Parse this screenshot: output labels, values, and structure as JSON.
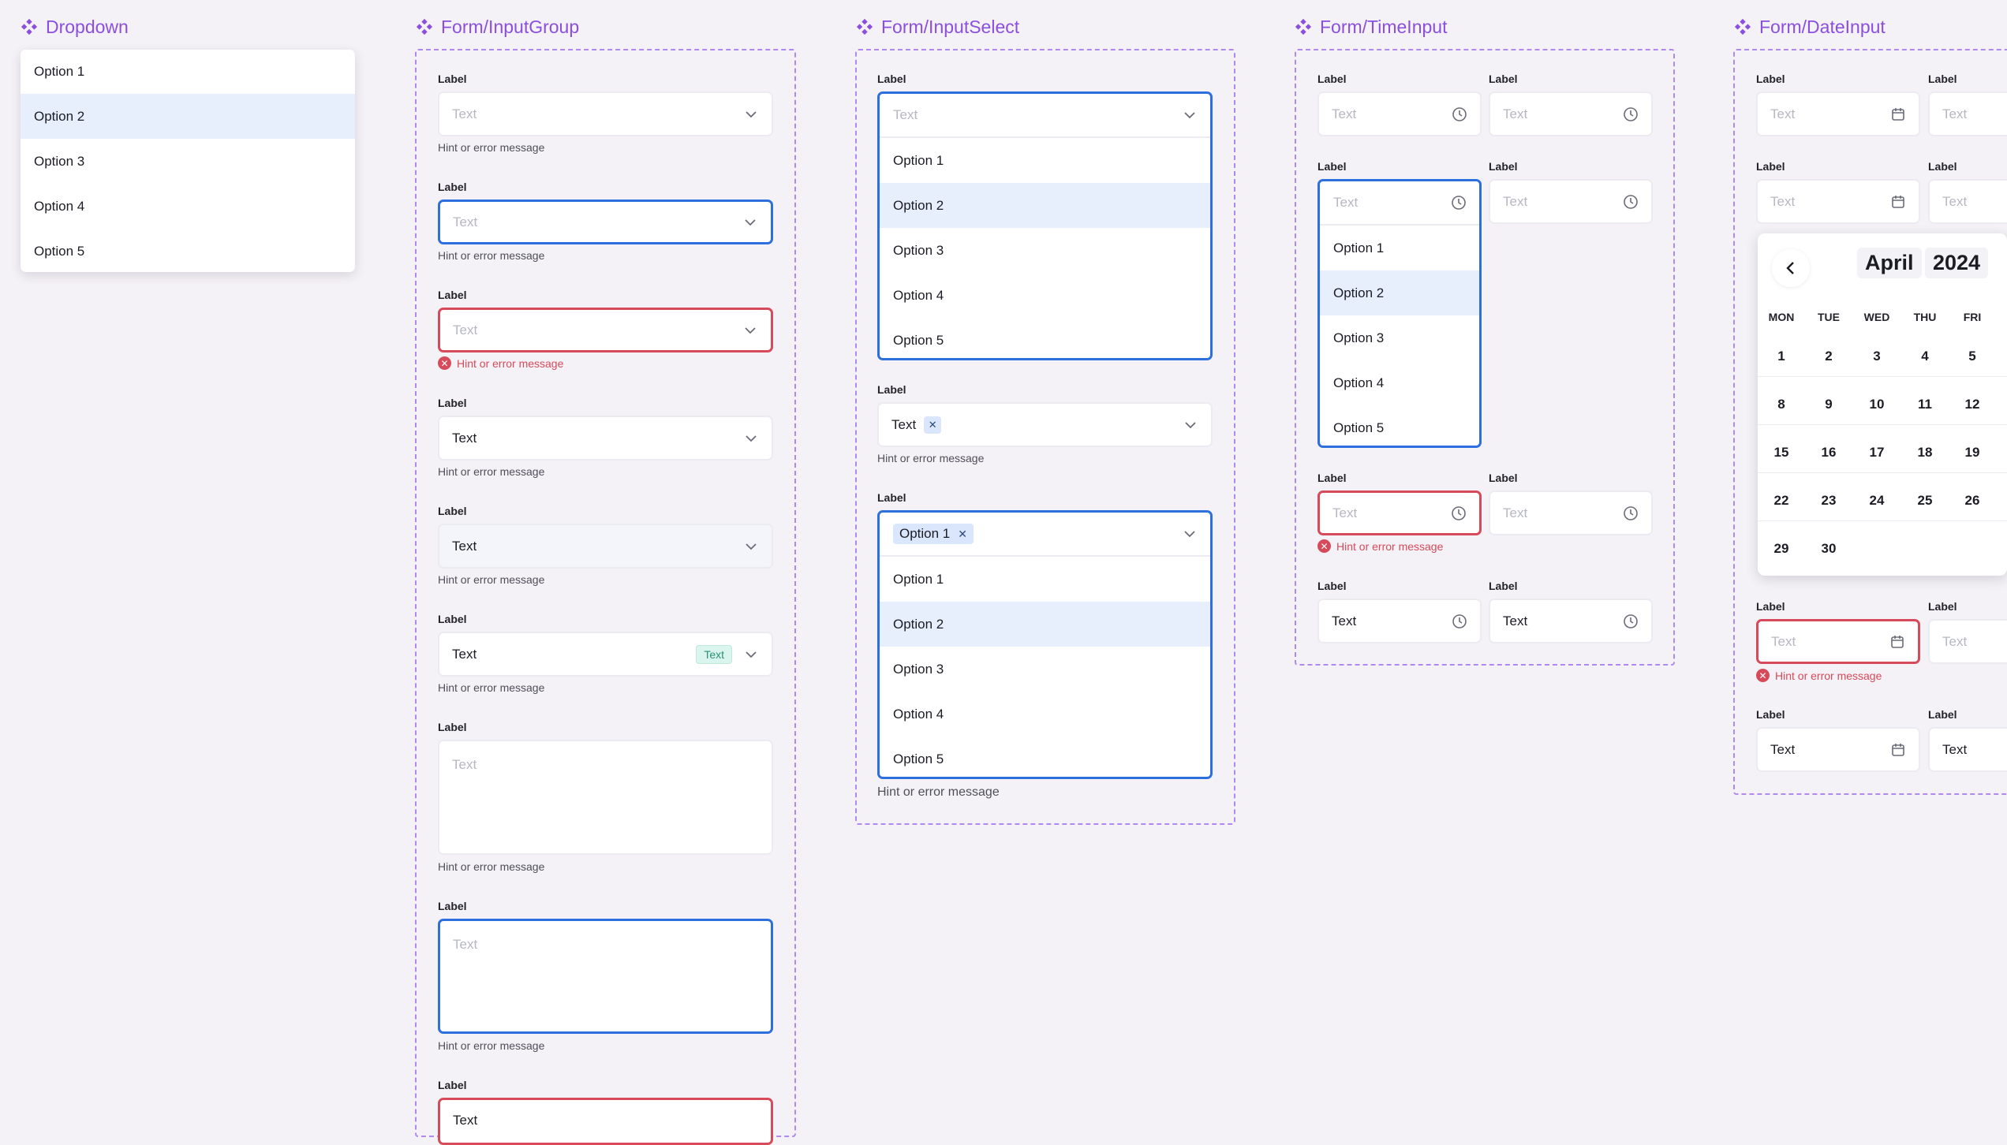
{
  "colors": {
    "accent_purple": "#8a4fdf",
    "focus_blue": "#2d6fdc",
    "error_red": "#d64a5a",
    "selected_row": "#e7effc",
    "tag_green": "#2f8f73"
  },
  "icons": {
    "section": "component-diamond-icon",
    "chevron": "chevron-down-icon",
    "clock": "clock-icon",
    "calendar": "calendar-icon",
    "error": "error-circle-icon",
    "remove": "close-icon",
    "prev": "chevron-left-icon"
  },
  "common": {
    "label": "Label",
    "placeholder": "Text",
    "value": "Text",
    "hint": "Hint or error message",
    "tag": "Text",
    "chip": "Option 1"
  },
  "sections": {
    "dropdown": {
      "title": "Dropdown",
      "options": [
        "Option 1",
        "Option 2",
        "Option 3",
        "Option 4",
        "Option 5"
      ],
      "selected_index": 1
    },
    "input_group": {
      "title": "Form/InputGroup"
    },
    "input_select": {
      "title": "Form/InputSelect",
      "options": [
        "Option 1",
        "Option 2",
        "Option 3",
        "Option 4",
        "Option 5"
      ],
      "selected_index": 1
    },
    "time_input": {
      "title": "Form/TimeInput",
      "options": [
        "Option 1",
        "Option 2",
        "Option 3",
        "Option 4",
        "Option 5"
      ],
      "selected_index": 1
    },
    "date_input": {
      "title": "Form/DateInput",
      "calendar": {
        "month": "April",
        "year": "2024",
        "weekdays": [
          "MON",
          "TUE",
          "WED",
          "THU",
          "FRI"
        ],
        "weeks": [
          [
            "1",
            "2",
            "3",
            "4",
            "5"
          ],
          [
            "8",
            "9",
            "10",
            "11",
            "12"
          ],
          [
            "15",
            "16",
            "17",
            "18",
            "19"
          ],
          [
            "22",
            "23",
            "24",
            "25",
            "26"
          ],
          [
            "29",
            "30"
          ]
        ]
      }
    }
  }
}
